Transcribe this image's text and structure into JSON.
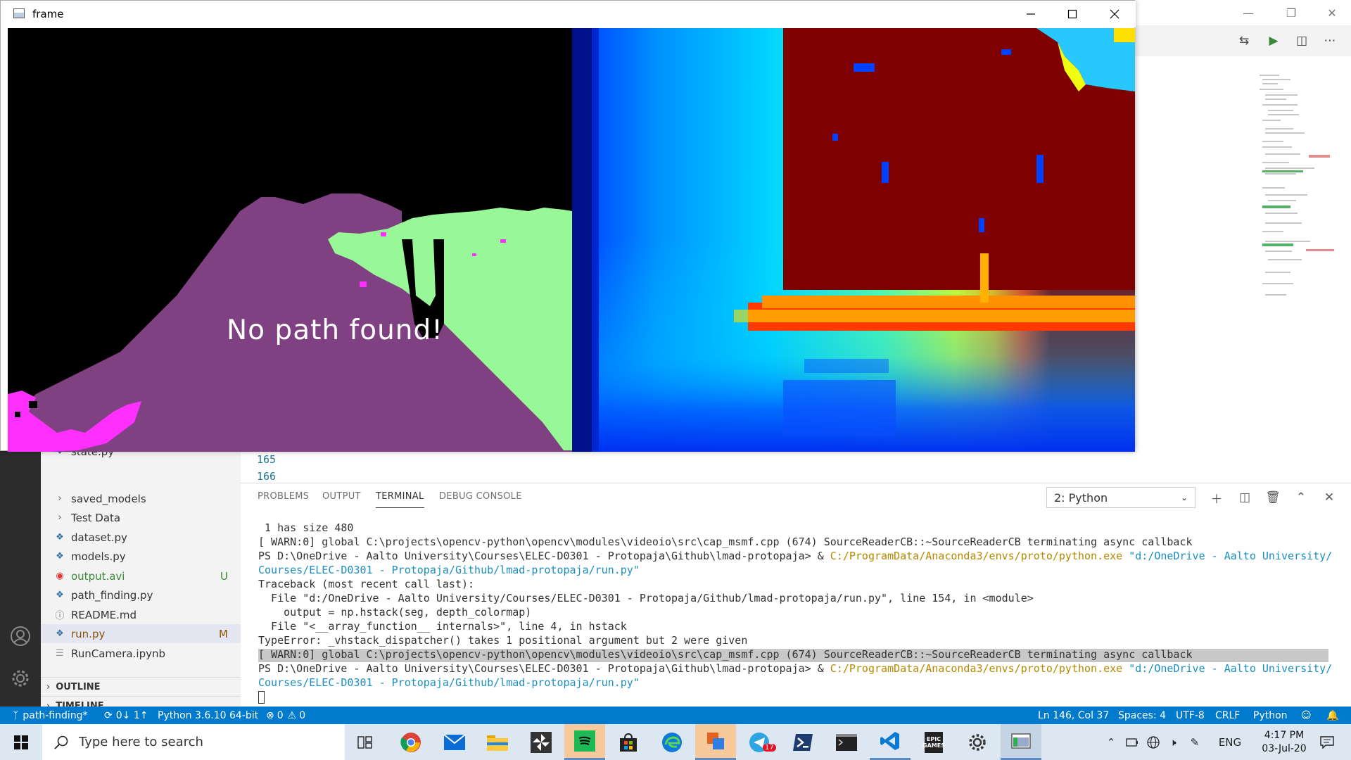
{
  "cv_window": {
    "title": "frame",
    "overlay_text": "No path found!"
  },
  "vscode": {
    "explorer": {
      "files": [
        {
          "name": "state.py",
          "icon": "python-file-icon",
          "badge": ""
        },
        {
          "name": "saved_models",
          "icon": "chevron-right-icon",
          "badge": ""
        },
        {
          "name": "Test Data",
          "icon": "chevron-right-icon",
          "badge": ""
        },
        {
          "name": "dataset.py",
          "icon": "python-file-icon",
          "badge": ""
        },
        {
          "name": "models.py",
          "icon": "python-file-icon",
          "badge": ""
        },
        {
          "name": "output.avi",
          "icon": "video-file-icon",
          "badge": "U"
        },
        {
          "name": "path_finding.py",
          "icon": "python-file-icon",
          "badge": ""
        },
        {
          "name": "README.md",
          "icon": "info-file-icon",
          "badge": ""
        },
        {
          "name": "run.py",
          "icon": "python-file-icon",
          "badge": "M"
        },
        {
          "name": "RunCamera.ipynb",
          "icon": "notebook-file-icon",
          "badge": ""
        }
      ],
      "outline_label": "OUTLINE",
      "timeline_label": "TIMELINE"
    },
    "editor": {
      "line_numbers": [
        "165",
        "166"
      ]
    },
    "panel": {
      "tabs": [
        "PROBLEMS",
        "OUTPUT",
        "TERMINAL",
        "DEBUG CONSOLE"
      ],
      "active_tab": "TERMINAL",
      "terminal_select": "2: Python",
      "terminal_lines": [
        " 1 has size 480",
        "[ WARN:0] global C:\\projects\\opencv-python\\opencv\\modules\\videoio\\src\\cap_msmf.cpp (674) SourceReaderCB::~SourceReaderCB terminating async callback",
        "PS D:\\OneDrive - Aalto University\\Courses\\ELEC-D0301 - Protopaja\\Github\\lmad-protopaja> & ",
        "C:/ProgramData/Anaconda3/envs/proto/python.exe",
        " \"d:/OneDrive - Aalto University/",
        "Courses/ELEC-D0301 - Protopaja/Github/lmad-protopaja/run.py\"",
        "Traceback (most recent call last):",
        "  File \"d:/OneDrive - Aalto University/Courses/ELEC-D0301 - Protopaja/Github/lmad-protopaja/run.py\", line 154, in <module>",
        "    output = np.hstack(seg, depth_colormap)",
        "  File \"<__array_function__ internals>\", line 4, in hstack",
        "TypeError: _vhstack_dispatcher() takes 1 positional argument but 2 were given",
        "[ WARN:0] global C:\\projects\\opencv-python\\opencv\\modules\\videoio\\src\\cap_msmf.cpp (674) SourceReaderCB::~SourceReaderCB terminating async callback",
        "PS D:\\OneDrive - Aalto University\\Courses\\ELEC-D0301 - Protopaja\\Github\\lmad-protopaja> & ",
        "C:/ProgramData/Anaconda3/envs/proto/python.exe",
        " \"d:/OneDrive - Aalto University/",
        "Courses/ELEC-D0301 - Protopaja/Github/lmad-protopaja/run.py\""
      ]
    },
    "statusbar": {
      "branch": "path-finding*",
      "sync": "0↓ 1↑",
      "interpreter": "Python 3.6.10 64-bit",
      "errors": "0",
      "warnings": "0",
      "cursor": "Ln 146, Col 37",
      "spaces": "Spaces: 4",
      "encoding": "UTF-8",
      "eol": "CRLF",
      "language": "Python"
    }
  },
  "taskbar": {
    "search_placeholder": "Type here to search",
    "apps": [
      "task-view",
      "chrome",
      "mail",
      "file-explorer",
      "app-pinwheel",
      "spotify",
      "microsoft-store",
      "edge",
      "office",
      "telegram",
      "powershell",
      "terminal",
      "vscode",
      "epic-games",
      "settings",
      "frame-window"
    ],
    "telegram_badge": "17",
    "epic_label": "EPIC GAMES",
    "language": "ENG",
    "time": "4:17 PM",
    "date": "03-Jul-20"
  },
  "colors": {
    "statusbar": "#007acc",
    "taskbar": "#dce7f2",
    "activitybar": "#2c2c2c",
    "seg_purple": "#7f4181",
    "seg_green": "#98f897",
    "seg_magenta": "#ff2fff",
    "depth_dark_red": "#7e0000"
  }
}
